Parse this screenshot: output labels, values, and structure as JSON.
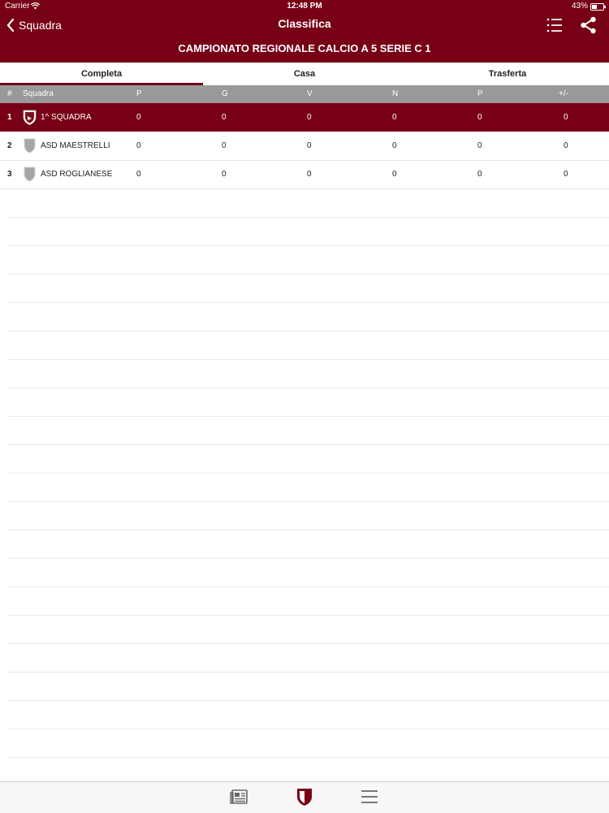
{
  "status_bar": {
    "carrier": "Carrier",
    "time": "12:48 PM",
    "battery": "43%",
    "battery_level": 0.43
  },
  "nav": {
    "back_label": "Squadra",
    "title": "Classifica"
  },
  "subtitle": "CAMPIONATO REGIONALE CALCIO A 5 SERIE C 1",
  "tabs": [
    {
      "label": "Completa",
      "active": true
    },
    {
      "label": "Casa",
      "active": false
    },
    {
      "label": "Trasferta",
      "active": false
    }
  ],
  "table": {
    "headers": [
      "#",
      "Squadra",
      "P",
      "G",
      "V",
      "N",
      "P",
      "+/-"
    ],
    "rows": [
      {
        "pos": "1",
        "team": "1^ SQUADRA",
        "values": [
          "0",
          "0",
          "0",
          "0",
          "0",
          "0"
        ],
        "highlight": true
      },
      {
        "pos": "2",
        "team": "ASD MAESTRELLI",
        "values": [
          "0",
          "0",
          "0",
          "0",
          "0",
          "0"
        ],
        "highlight": false
      },
      {
        "pos": "3",
        "team": "ASD ROGLIANESE",
        "values": [
          "0",
          "0",
          "0",
          "0",
          "0",
          "0"
        ],
        "highlight": false
      }
    ]
  },
  "bottom_nav": [
    {
      "icon": "news-icon"
    },
    {
      "icon": "shield-icon",
      "active": true
    },
    {
      "icon": "menu-icon"
    }
  ],
  "colors": {
    "brand": "#770016",
    "header_gray": "#999999"
  }
}
